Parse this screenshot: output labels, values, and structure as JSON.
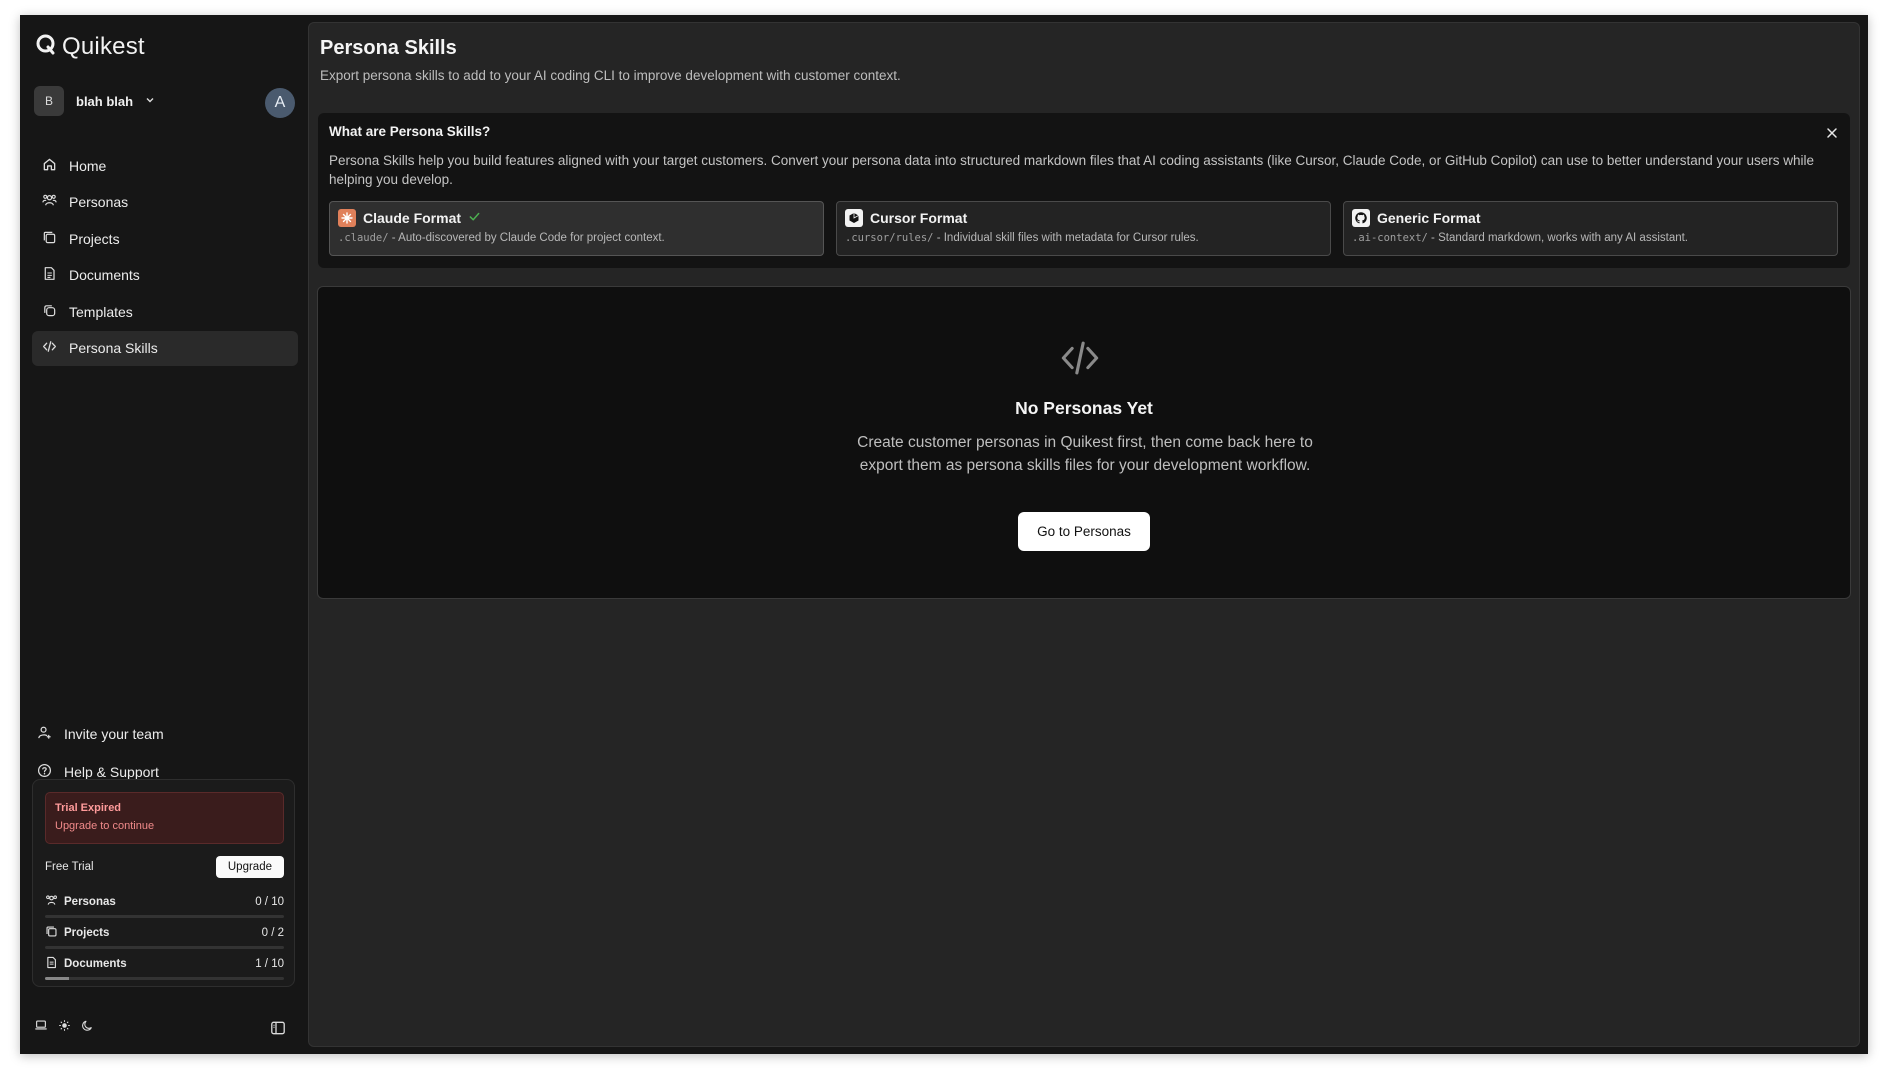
{
  "brand": {
    "name": "Quikest"
  },
  "workspace": {
    "badge": "B",
    "name": "blah blah"
  },
  "user": {
    "avatar_letter": "A"
  },
  "nav": [
    {
      "label": "Home",
      "icon": "home-icon"
    },
    {
      "label": "Personas",
      "icon": "users-icon"
    },
    {
      "label": "Projects",
      "icon": "layers-icon"
    },
    {
      "label": "Documents",
      "icon": "document-icon"
    },
    {
      "label": "Templates",
      "icon": "copy-icon"
    },
    {
      "label": "Persona Skills",
      "icon": "code-icon",
      "active": true
    }
  ],
  "bottom_links": {
    "invite": "Invite your team",
    "help": "Help & Support"
  },
  "plan": {
    "trial_title": "Trial Expired",
    "trial_sub": "Upgrade to continue",
    "name": "Free Trial",
    "upgrade_label": "Upgrade",
    "usage": [
      {
        "label": "Personas",
        "count": "0 / 10",
        "fraction": 0.0
      },
      {
        "label": "Projects",
        "count": "0 / 2",
        "fraction": 0.0
      },
      {
        "label": "Documents",
        "count": "1 / 10",
        "fraction": 0.1
      }
    ]
  },
  "page": {
    "title": "Persona Skills",
    "subtitle": "Export persona skills to add to your AI coding CLI to improve development with customer context."
  },
  "info": {
    "title": "What are Persona Skills?",
    "text": "Persona Skills help you build features aligned with your target customers. Convert your persona data into structured markdown files that AI coding assistants (like Cursor, Claude Code, or GitHub Copilot) can use to better understand your users while helping you develop.",
    "formats": [
      {
        "name": "Claude Format",
        "path": ".claude/",
        "desc": " - Auto-discovered by Claude Code for project context.",
        "selected": true
      },
      {
        "name": "Cursor Format",
        "path": ".cursor/rules/",
        "desc": " - Individual skill files with metadata for Cursor rules.",
        "selected": false
      },
      {
        "name": "Generic Format",
        "path": ".ai-context/",
        "desc": " - Standard markdown, works with any AI assistant.",
        "selected": false
      }
    ]
  },
  "empty": {
    "title": "No Personas Yet",
    "desc": "Create customer personas in Quikest first, then come back here to export them as persona skills files for your development workflow.",
    "button": "Go to Personas"
  },
  "colors": {
    "background": "#161616",
    "main": "#252525",
    "trial_bg": "#3a1c1c",
    "trial_text": "#ff9b9b",
    "check": "#4caf50",
    "claude": "#e0805a"
  }
}
